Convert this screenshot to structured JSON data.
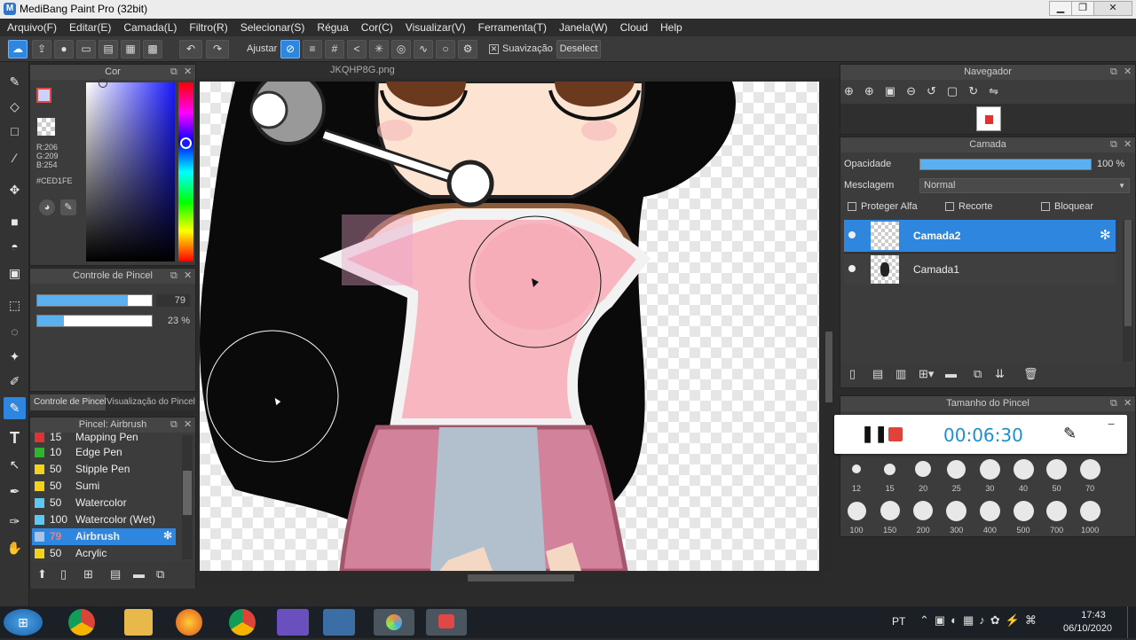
{
  "window": {
    "title": "MediBang Paint Pro (32bit)",
    "minimize": "▁",
    "maximize": "❐",
    "close": "✕"
  },
  "menu": [
    "Arquivo(F)",
    "Editar(E)",
    "Camada(L)",
    "Filtro(R)",
    "Selecionar(S)",
    "Régua",
    "Cor(C)",
    "Visualizar(V)",
    "Ferramenta(T)",
    "Janela(W)",
    "Cloud",
    "Help"
  ],
  "toolbar": {
    "adjust_label": "Ajustar",
    "smoothing_label": "Suavização",
    "deselect_label": "Deselect"
  },
  "color_panel": {
    "title": "Cor",
    "r": "R:206",
    "g": "G:209",
    "b": "B:254",
    "hex": "#CED1FE",
    "current_color": "#CED1FE"
  },
  "brush_control": {
    "title": "Controle de Pincel",
    "size_value": "79",
    "opacity_value": "23 %",
    "size_fraction": 0.79,
    "opacity_fraction": 0.23,
    "tab1": "Controle de Pincel",
    "tab2": "Visualização do Pincel"
  },
  "brush_list": {
    "title": "Pincel: Airbrush",
    "items": [
      {
        "size": "15",
        "name": "Mapping Pen",
        "color": "#d33"
      },
      {
        "size": "10",
        "name": "Edge Pen",
        "color": "#2db52d"
      },
      {
        "size": "50",
        "name": "Stipple Pen",
        "color": "#f2d21b"
      },
      {
        "size": "50",
        "name": "Sumi",
        "color": "#f2d21b"
      },
      {
        "size": "50",
        "name": "Watercolor",
        "color": "#5ec8f2"
      },
      {
        "size": "100",
        "name": "Watercolor (Wet)",
        "color": "#5ec8f2"
      },
      {
        "size": "79",
        "name": "Airbrush",
        "color": "#aac4e8"
      },
      {
        "size": "50",
        "name": "Acrylic",
        "color": "#f2d21b"
      }
    ]
  },
  "document": {
    "filename": "JKQHP8G.png"
  },
  "navigator": {
    "title": "Navegador"
  },
  "layers": {
    "title": "Camada",
    "opacity_label": "Opacidade",
    "opacity_value": "100 %",
    "opacity_fraction": 1.0,
    "blend_label": "Mesclagem",
    "blend_value": "Normal",
    "protect_alpha": "Proteger Alfa",
    "clip": "Recorte",
    "lock": "Bloquear",
    "items": [
      {
        "name": "Camada2"
      },
      {
        "name": "Camada1"
      }
    ]
  },
  "brush_size": {
    "title": "Tamanho do Pincel",
    "sizes_row1": [
      "12",
      "15",
      "20",
      "25",
      "30",
      "40",
      "50",
      "70"
    ],
    "sizes_row2": [
      "100",
      "150",
      "200",
      "300",
      "400",
      "500",
      "700",
      "1000"
    ]
  },
  "recorder": {
    "time": "00:06:30"
  },
  "taskbar": {
    "lang": "PT",
    "time": "17:43",
    "date": "06/10/2020"
  }
}
